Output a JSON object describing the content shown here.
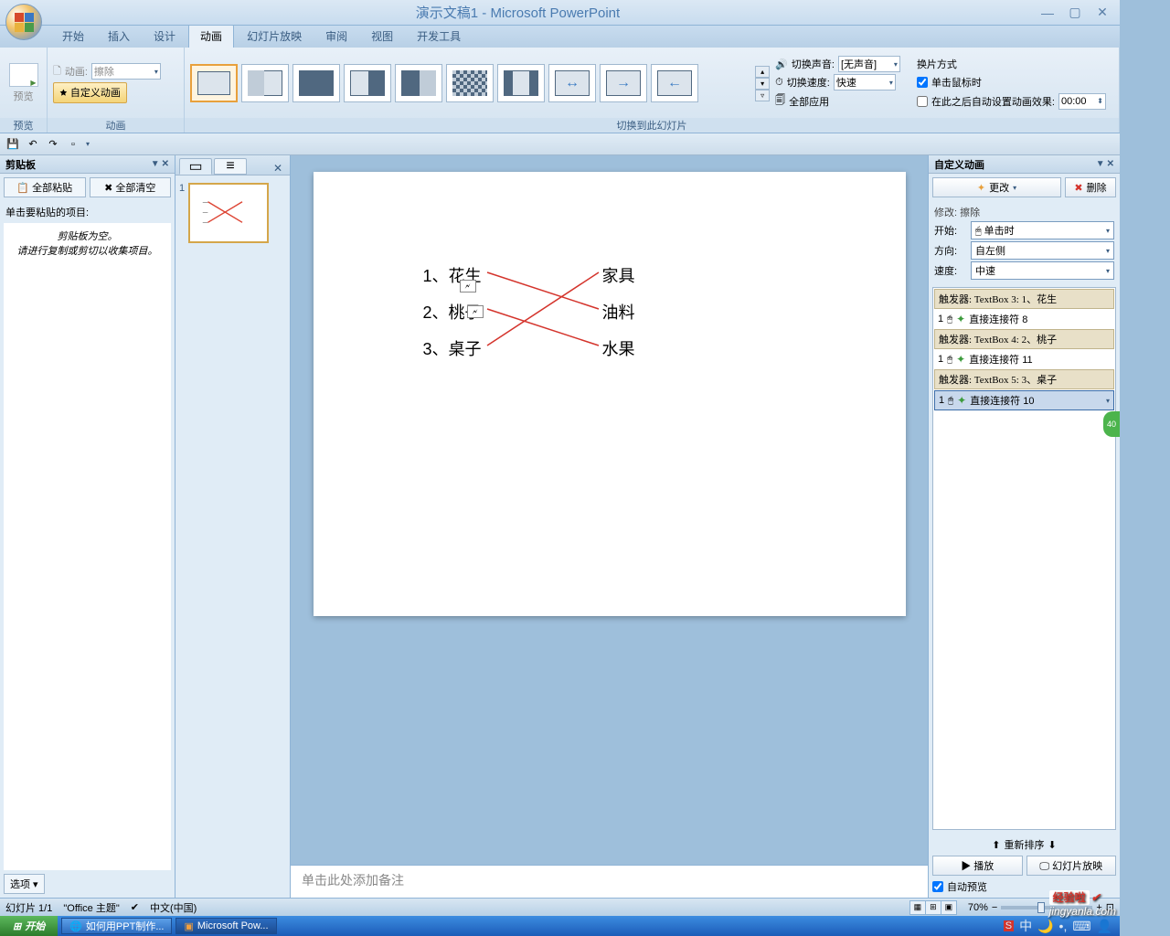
{
  "title": "演示文稿1 - Microsoft PowerPoint",
  "ribbon_tabs": [
    "开始",
    "插入",
    "设计",
    "动画",
    "幻灯片放映",
    "审阅",
    "视图",
    "开发工具"
  ],
  "active_tab": 3,
  "groups": {
    "preview": {
      "btn": "预览",
      "label": "预览"
    },
    "anim": {
      "label": "动画",
      "anim_label": "动画:",
      "anim_value": "擦除",
      "custom_btn": "自定义动画"
    },
    "transition": {
      "label": "切换到此幻灯片",
      "sound_label": "切换声音:",
      "sound_value": "[无声音]",
      "speed_label": "切换速度:",
      "speed_value": "快速",
      "apply_all": "全部应用"
    },
    "switch": {
      "title": "换片方式",
      "mouse": "单击鼠标时",
      "auto": "在此之后自动设置动画效果:",
      "time": "00:00"
    }
  },
  "clipboard": {
    "title": "剪贴板",
    "paste_all": "全部粘贴",
    "clear_all": "全部清空",
    "msg": "单击要粘贴的项目:",
    "empty": "剪贴板为空。\n请进行复制或剪切以收集项目。",
    "options": "选项"
  },
  "thumb": {
    "num": "1"
  },
  "slide": {
    "items_left": [
      "1、花生",
      "2、桃子",
      "3、桌子"
    ],
    "items_right": [
      "家具",
      "油料",
      "水果"
    ]
  },
  "notes_placeholder": "单击此处添加备注",
  "anim_pane": {
    "title": "自定义动画",
    "change": "更改",
    "remove": "删除",
    "modify": "修改: 擦除",
    "start_label": "开始:",
    "start_value": "单击时",
    "dir_label": "方向:",
    "dir_value": "自左侧",
    "speed_label": "速度:",
    "speed_value": "中速",
    "triggers": [
      {
        "hdr": "触发器: TextBox 3: 1、花生",
        "item": "直接连接符 8",
        "num": "1"
      },
      {
        "hdr": "触发器: TextBox 4: 2、桃子",
        "item": "直接连接符 11",
        "num": "1"
      },
      {
        "hdr": "触发器: TextBox 5: 3、桌子",
        "item": "直接连接符 10",
        "num": "1"
      }
    ],
    "reorder": "重新排序",
    "play": "播放",
    "slideshow": "幻灯片放映",
    "autopreview": "自动预览"
  },
  "status": {
    "slide": "幻灯片 1/1",
    "theme": "\"Office 主题\"",
    "lang": "中文(中国)",
    "zoom": "70%"
  },
  "taskbar": {
    "start": "开始",
    "tasks": [
      "如何用PPT制作...",
      "Microsoft Pow..."
    ]
  },
  "watermark": {
    "logo": "经验啦",
    "url": "jingyanla.com"
  }
}
